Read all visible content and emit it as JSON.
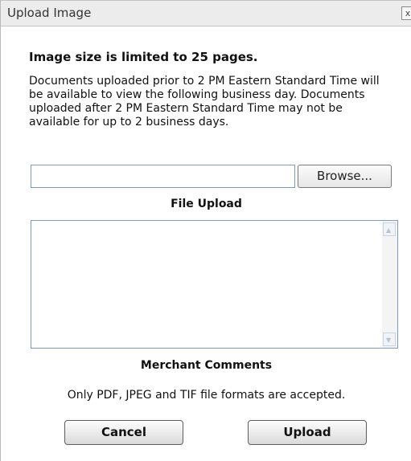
{
  "dialog": {
    "title": "Upload Image",
    "close_label": "x"
  },
  "content": {
    "heading": "Image size is limited to 25 pages.",
    "description": "Documents uploaded prior to 2 PM Eastern Standard Time will be available to view the following business day. Documents uploaded after 2 PM Eastern Standard Time may not be available for up to 2 business days."
  },
  "file_upload": {
    "value": "",
    "browse_label": "Browse...",
    "label": "File Upload"
  },
  "comments": {
    "value": "",
    "label": "Merchant Comments"
  },
  "formats_note": "Only PDF, JPEG and TIF file formats are accepted.",
  "buttons": {
    "cancel": "Cancel",
    "upload": "Upload"
  },
  "icons": {
    "close": "close-icon",
    "scroll_up": "chevron-up-icon",
    "scroll_down": "chevron-down-icon"
  }
}
